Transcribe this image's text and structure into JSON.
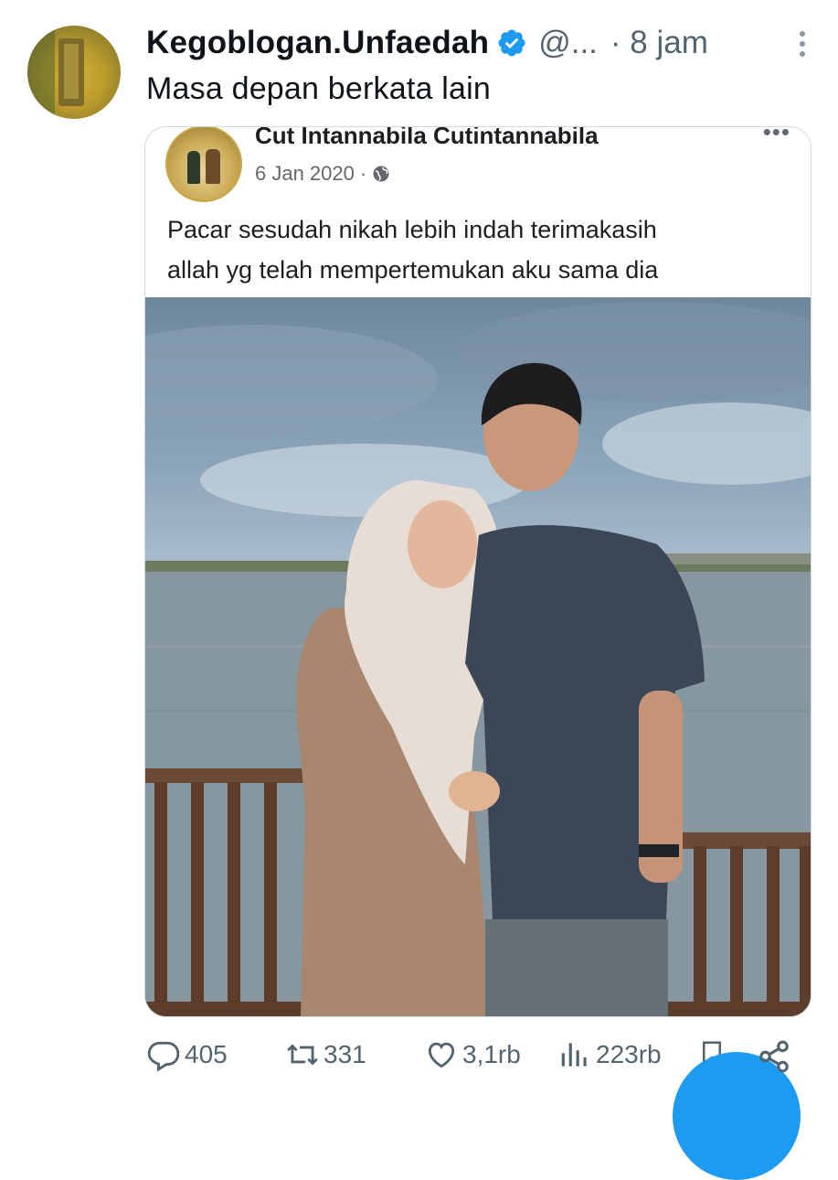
{
  "tweet": {
    "display_name": "Kegoblogan.Unfaedah",
    "handle": "@...",
    "time": "· 8 jam",
    "text": "Masa depan berkata lain"
  },
  "embedded_post": {
    "name": "Cut Intannabila Cutintannabila",
    "more": "•••",
    "date": "6 Jan 2020",
    "date_sep": "·",
    "body_line1": "Pacar sesudah nikah lebih indah terimakasih",
    "body_line2": "allah yg telah mempertemukan aku sama dia"
  },
  "actions": {
    "replies": "405",
    "retweets": "331",
    "likes": "3,1rb",
    "views": "223rb"
  },
  "icons": {
    "verified": "verified-badge-icon",
    "more": "more-vertical-icon",
    "reply": "reply-icon",
    "retweet": "retweet-icon",
    "like": "heart-icon",
    "views": "views-icon",
    "bookmark": "bookmark-icon",
    "share": "share-icon",
    "globe": "globe-icon"
  },
  "colors": {
    "accent": "#1d9bf0",
    "muted": "#536471",
    "text": "#0f1419"
  }
}
